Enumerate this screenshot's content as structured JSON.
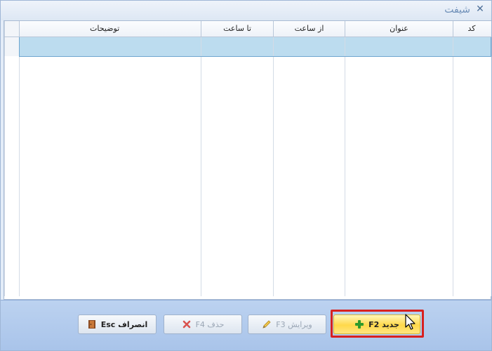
{
  "window": {
    "title": "شیفت",
    "close_glyph": "✕"
  },
  "grid": {
    "columns": [
      {
        "key": "code",
        "label": "کد"
      },
      {
        "key": "title",
        "label": "عنوان"
      },
      {
        "key": "from",
        "label": "از ساعت"
      },
      {
        "key": "to",
        "label": "تا ساعت"
      },
      {
        "key": "desc",
        "label": "توضیحات"
      }
    ],
    "rows": [
      {
        "code": "",
        "title": "",
        "from": "",
        "to": "",
        "desc": ""
      }
    ]
  },
  "buttons": {
    "new": {
      "label": "جدید F2",
      "icon": "plus-icon",
      "color": "#ffd84a"
    },
    "edit": {
      "label": "ویرایش F3",
      "icon": "pencil-icon"
    },
    "delete": {
      "label": "حذف F4",
      "icon": "delete-icon"
    },
    "cancel": {
      "label": "انصراف Esc",
      "icon": "door-icon"
    }
  },
  "colors": {
    "highlight": "#d8201f",
    "selected_row": "#bcdcef",
    "footer": "#b3cbee"
  }
}
